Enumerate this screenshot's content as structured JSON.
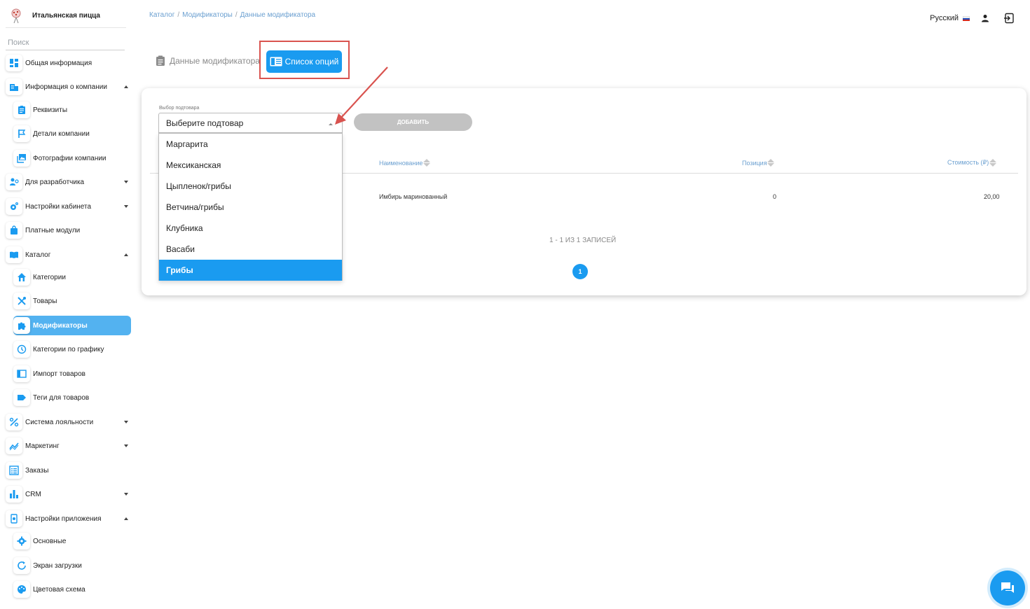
{
  "brand": {
    "name": "Итальянская пицца"
  },
  "search": {
    "placeholder": "Поиск"
  },
  "sidebar": {
    "items": [
      {
        "label": "Общая информация",
        "icon": "dashboard-icon"
      },
      {
        "label": "Информация о компании",
        "icon": "building-icon",
        "expanded": true
      },
      {
        "label": "Реквизиты",
        "icon": "clipboard-icon"
      },
      {
        "label": "Детали компании",
        "icon": "flag-icon"
      },
      {
        "label": "Фотографии компании",
        "icon": "photos-icon"
      },
      {
        "label": "Для разработчика",
        "icon": "developer-icon",
        "expanded": false
      },
      {
        "label": "Настройки кабинета",
        "icon": "settings-gear-icon",
        "expanded": false
      },
      {
        "label": "Платные модули",
        "icon": "shopping-bag-icon"
      },
      {
        "label": "Каталог",
        "icon": "book-icon",
        "expanded": true
      },
      {
        "label": "Категории",
        "icon": "home-icon"
      },
      {
        "label": "Товары",
        "icon": "cutlery-icon"
      },
      {
        "label": "Модификаторы",
        "icon": "puzzle-icon",
        "active": true
      },
      {
        "label": "Категории по графику",
        "icon": "clock-icon"
      },
      {
        "label": "Импорт товаров",
        "icon": "import-icon"
      },
      {
        "label": "Теги для товаров",
        "icon": "tag-icon"
      },
      {
        "label": "Система лояльности",
        "icon": "percent-icon",
        "expanded": false
      },
      {
        "label": "Маркетинг",
        "icon": "trend-icon",
        "expanded": false
      },
      {
        "label": "Заказы",
        "icon": "list-icon"
      },
      {
        "label": "CRM",
        "icon": "bar-chart-icon",
        "expanded": false
      },
      {
        "label": "Настройки приложения",
        "icon": "phone-settings-icon",
        "expanded": true
      },
      {
        "label": "Основные",
        "icon": "gear-icon"
      },
      {
        "label": "Экран загрузки",
        "icon": "refresh-icon"
      },
      {
        "label": "Цветовая схема",
        "icon": "palette-icon"
      }
    ]
  },
  "breadcrumb": {
    "items": [
      "Каталог",
      "Модификаторы",
      "Данные модификатора"
    ],
    "separator": "/"
  },
  "topbar": {
    "language": "Русский"
  },
  "tabs": {
    "data_label": "Данные модификатора",
    "options_label": "Список опций"
  },
  "form": {
    "select_label": "Выбор подтовара",
    "select_placeholder": "Выберите подтовар",
    "add_button": "ДОБАВИТЬ"
  },
  "dropdown": {
    "options": [
      "Маргарита",
      "Мексиканская",
      "Цыпленок/грибы",
      "Ветчина/грибы",
      "Клубника",
      "Васаби",
      "Грибы"
    ],
    "highlighted": "Грибы"
  },
  "table": {
    "columns": [
      "Наименование",
      "Позиция",
      "Стоимость (₽)"
    ],
    "rows": [
      {
        "name": "Имбирь маринованный",
        "position": "0",
        "price": "20,00"
      }
    ],
    "records_text": "1 - 1 ИЗ 1 ЗАПИСЕЙ",
    "current_page": "1"
  },
  "colors": {
    "primary": "#1a9bf0",
    "sidebar_active": "#53b2f0",
    "annotation": "#d9534f",
    "disabled": "#c2c2c2"
  }
}
